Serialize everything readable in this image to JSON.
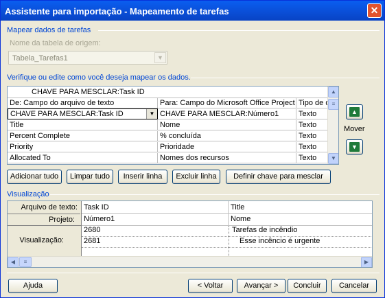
{
  "window": {
    "title": "Assistente para importação - Mapeamento de tarefas",
    "close_glyph": "✕"
  },
  "map_section": {
    "title": "Mapear dados de tarefas",
    "source_table_label": "Nome da tabela de origem:",
    "source_table_value": "Tabela_Tarefas1",
    "verify_label": "Verifique ou edite como você deseja mapear os dados."
  },
  "mapping_grid": {
    "top_row": "CHAVE PARA MESCLAR:Task ID",
    "headers": [
      "De: Campo do arquivo de texto",
      "Para: Campo do Microsoft Office Project",
      "Tipo de d"
    ],
    "rows": [
      [
        "CHAVE PARA MESCLAR:Task ID",
        "CHAVE PARA MESCLAR:Número1",
        "Texto"
      ],
      [
        "Title",
        "Nome",
        "Texto"
      ],
      [
        "Percent Complete",
        "% concluída",
        "Texto"
      ],
      [
        "Priority",
        "Prioridade",
        "Texto"
      ],
      [
        "Allocated To",
        "Nomes dos recursos",
        "Texto"
      ]
    ]
  },
  "move": {
    "label": "Mover",
    "up_icon": "arrow-up-icon",
    "down_icon": "arrow-down-icon",
    "up_glyph": "▲",
    "down_glyph": "▼"
  },
  "grid_buttons": {
    "add_all": "Adicionar tudo",
    "clear_all": "Limpar tudo",
    "insert_row": "Inserir linha",
    "delete_row": "Excluir linha",
    "set_merge_key": "Definir chave para mesclar"
  },
  "preview": {
    "title": "Visualização",
    "row_labels": {
      "text_file": "Arquivo de texto:",
      "project": "Projeto:",
      "preview": "Visualização:"
    },
    "columns": [
      {
        "text_file": "Task ID",
        "project": "Número1",
        "values": [
          "2680",
          "2681"
        ]
      },
      {
        "text_file": "Title",
        "project": "Nome",
        "values": [
          "Tarefas de incêndio",
          "Esse incêncio é urgente"
        ]
      }
    ]
  },
  "footer": {
    "help": "Ajuda",
    "back": "< Voltar",
    "next": "Avançar >",
    "finish": "Concluir",
    "cancel": "Cancelar"
  },
  "scroll_glyphs": {
    "up": "▲",
    "down": "▼",
    "left": "◀",
    "right": "▶",
    "grip": "≡",
    "combo_arrow": "▼"
  },
  "colors": {
    "titlebar": "#0a5ef0",
    "section_title": "#0046d5",
    "disabled_text": "#a8a694",
    "close_button": "#e2542e",
    "dialog_bg": "#ece9d8"
  }
}
